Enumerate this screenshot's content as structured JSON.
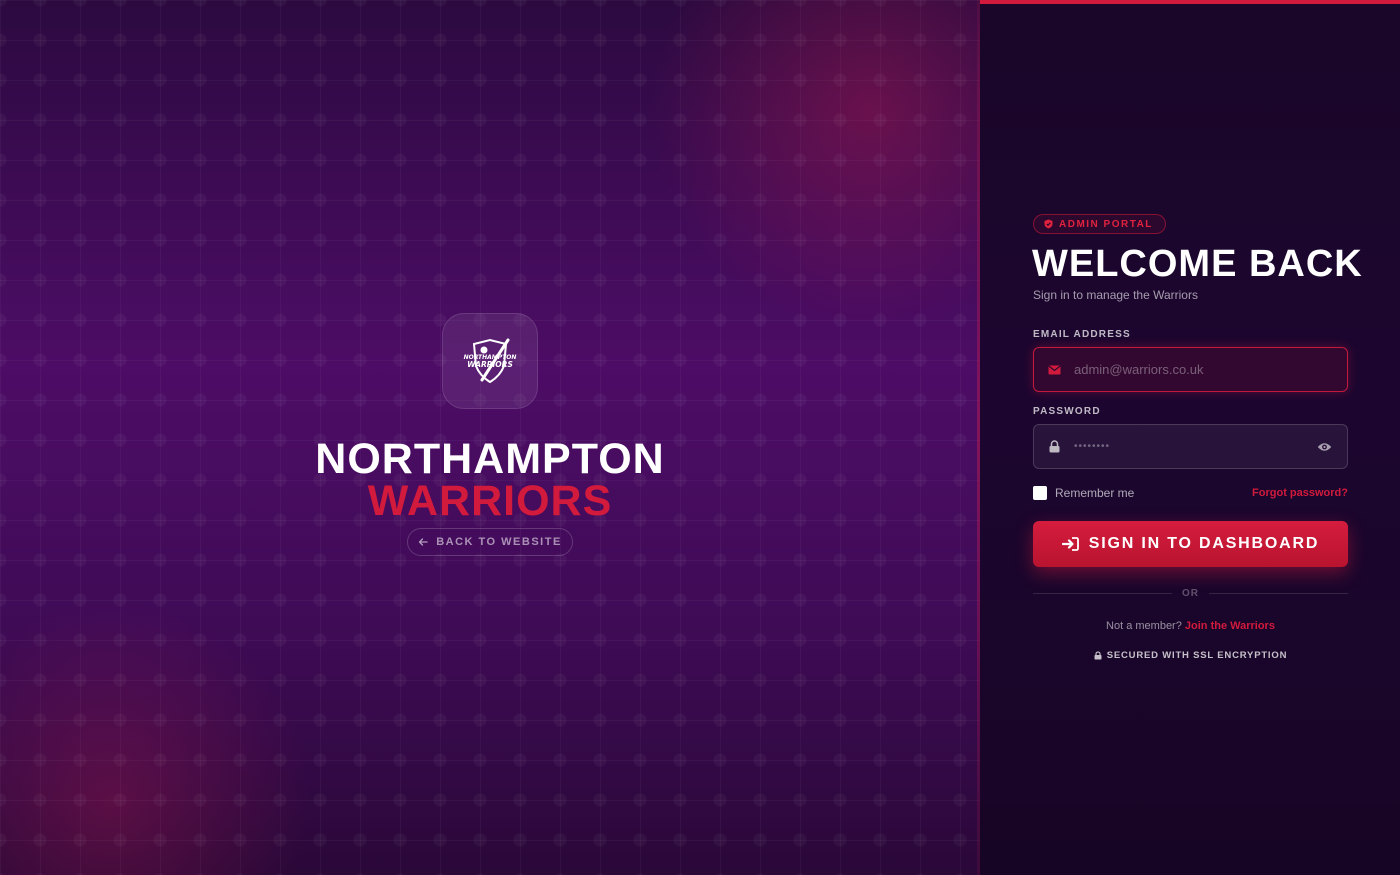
{
  "brand": {
    "logo_text_top": "NORTHAMPTON",
    "logo_text_bottom": "WARRIORS",
    "line1": "NORTHAMPTON",
    "line2": "WARRIORS",
    "back_label": "BACK TO WEBSITE"
  },
  "login": {
    "badge": "ADMIN PORTAL",
    "title": "WELCOME BACK",
    "subtitle": "Sign in to manage the Warriors",
    "email_label": "EMAIL ADDRESS",
    "email_placeholder": "admin@warriors.co.uk",
    "password_label": "PASSWORD",
    "password_value": "••••••••",
    "remember_label": "Remember me",
    "forgot_label": "Forgot password?",
    "submit_label": "SIGN IN TO DASHBOARD",
    "or_label": "OR",
    "not_member": "Not a member? ",
    "join_label": "Join the Warriors",
    "ssl_label": "SECURED WITH SSL ENCRYPTION"
  },
  "colors": {
    "accent": "#d21a3c",
    "panel_bg": "#1a0628",
    "left_bg": "#4d0c66"
  },
  "icons": {
    "badge": "shield-icon",
    "back": "arrow-left-icon",
    "email": "envelope-icon",
    "password": "lock-icon",
    "toggle": "eye-icon",
    "submit": "sign-in-icon",
    "ssl": "lock-icon"
  }
}
